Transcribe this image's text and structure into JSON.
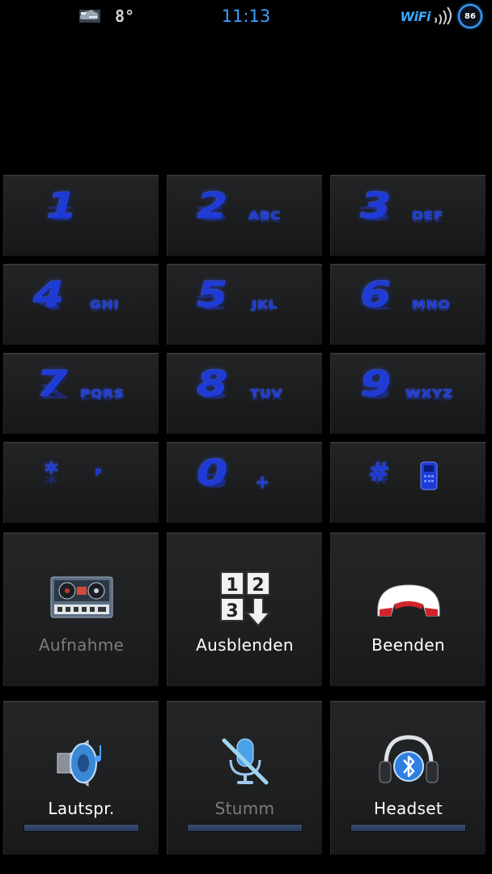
{
  "status_bar": {
    "weather_icon": "cloud-weather-icon",
    "temperature": "8°",
    "time": "11:13",
    "wifi_label": "WiFi",
    "signal_icon": "signal-strength-icon",
    "battery_level": "86"
  },
  "keypad": {
    "keys": [
      {
        "digit": "1",
        "letters": ""
      },
      {
        "digit": "2",
        "letters": "ABC"
      },
      {
        "digit": "3",
        "letters": "DEF"
      },
      {
        "digit": "4",
        "letters": "GHI"
      },
      {
        "digit": "5",
        "letters": "JKL"
      },
      {
        "digit": "6",
        "letters": "MNO"
      },
      {
        "digit": "7",
        "letters": "PQRS"
      },
      {
        "digit": "8",
        "letters": "TUV"
      },
      {
        "digit": "9",
        "letters": "WXYZ"
      },
      {
        "digit": "*",
        "letters": "P"
      },
      {
        "digit": "0",
        "letters": "+"
      },
      {
        "digit": "#",
        "letters": ""
      }
    ],
    "hash_key_icon": "phone-handset-icon"
  },
  "actions": {
    "record": {
      "label": "Aufnahme",
      "icon": "tape-recorder-icon",
      "enabled": false
    },
    "hide": {
      "label": "Ausblenden",
      "icon": "dialpad-hide-icon",
      "enabled": true
    },
    "end": {
      "label": "Beenden",
      "icon": "end-call-icon",
      "enabled": true
    },
    "speaker": {
      "label": "Lautspr.",
      "icon": "speaker-icon",
      "enabled": true
    },
    "mute": {
      "label": "Stumm",
      "icon": "microphone-muted-icon",
      "enabled": false
    },
    "headset": {
      "label": "Headset",
      "icon": "bluetooth-headset-icon",
      "enabled": true
    }
  },
  "colors": {
    "accent": "#1f3bd6",
    "time": "#3aa0ff",
    "indicator_bar": "#2f4268"
  }
}
